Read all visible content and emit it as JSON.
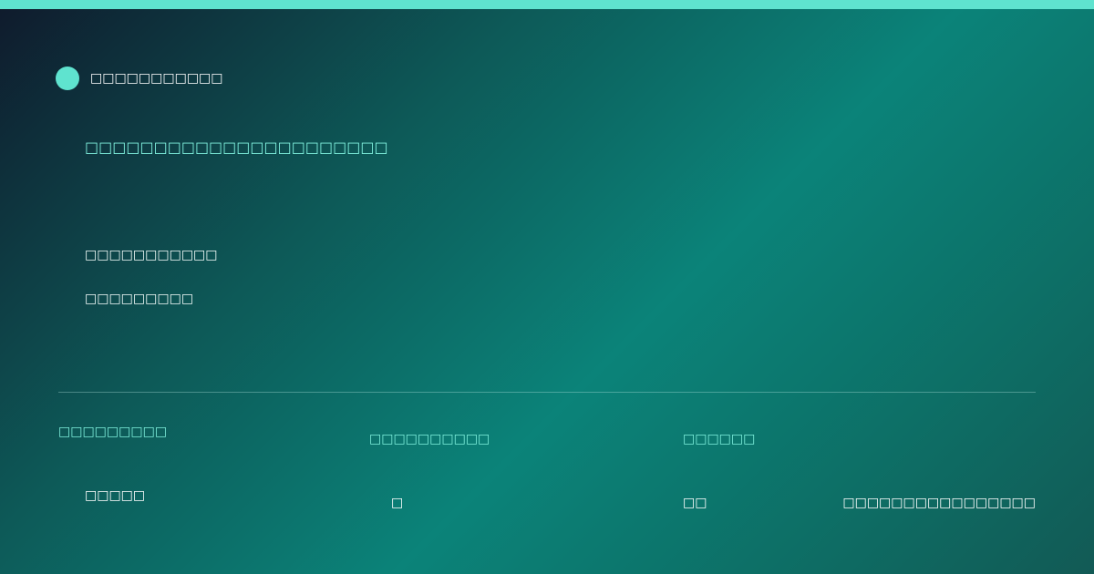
{
  "colors": {
    "accent": "#5fe3cf",
    "accent_text": "#7ff0dd",
    "text": "#ffffff",
    "bg_dark": "#0f1a2c",
    "bg_teal": "#0b8379"
  },
  "header": {
    "brand_icon": "circle-logo-icon",
    "brand_name": "□□□□□□□□□□□"
  },
  "hero": {
    "headline": "□□□□□□□□□□□□□□□□□□□□□□",
    "line_1": "□□□□□□□□□□□",
    "line_2": "□□□□□□□□□"
  },
  "stats": [
    {
      "label": "□□□□□□□□□",
      "value": "□□□□□"
    },
    {
      "label": "□□□□□□□□□□",
      "value": "□"
    },
    {
      "label": "□□□□□□",
      "value": "□□"
    }
  ],
  "footer_note": "□□□□□□□□□□□□□□□□"
}
